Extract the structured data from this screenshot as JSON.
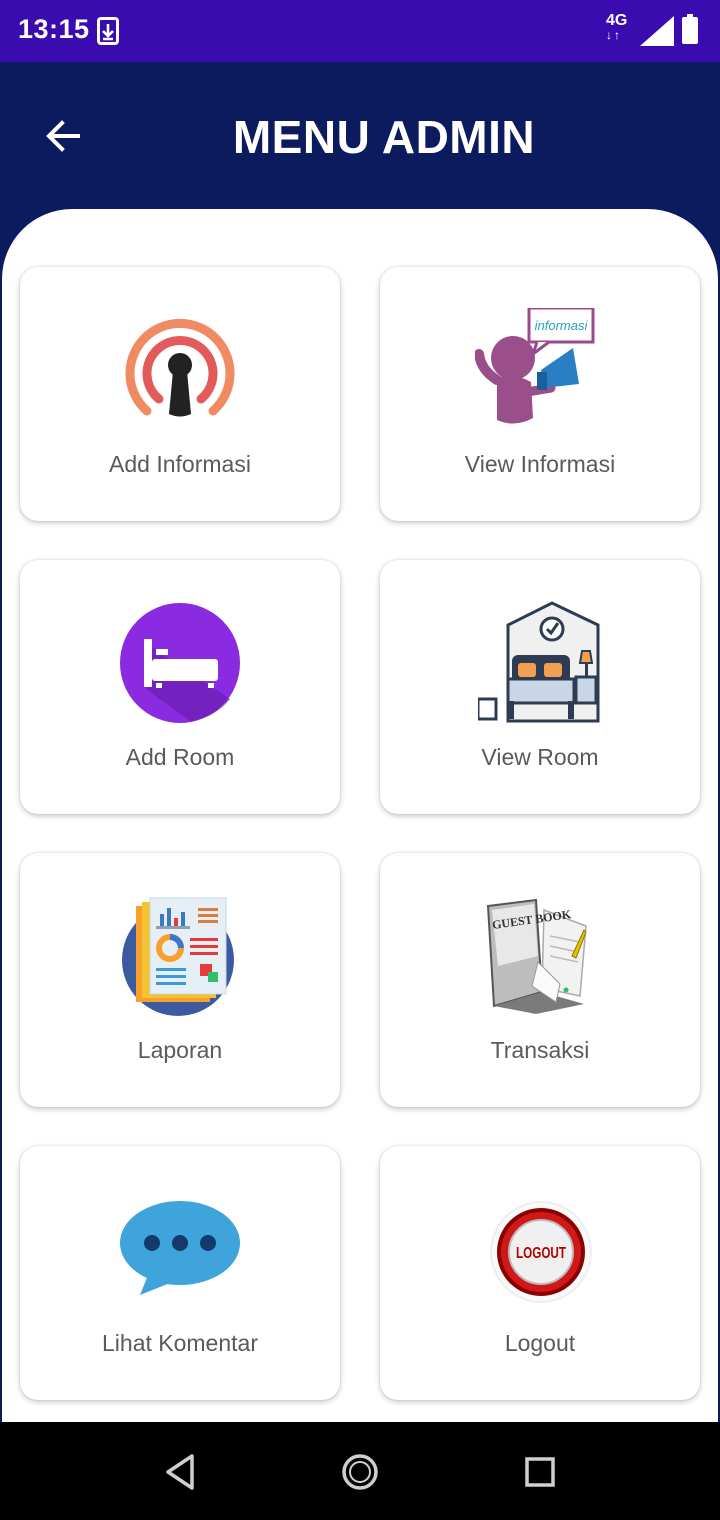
{
  "status_bar": {
    "time": "13:15",
    "network": "4G",
    "network_arrows": "↓↑"
  },
  "header": {
    "title": "MENU ADMIN",
    "back_icon": "arrow-back-icon"
  },
  "menu": [
    {
      "label": "Add Informasi",
      "icon": "broadcast-icon"
    },
    {
      "label": "View Informasi",
      "icon": "announcer-icon",
      "icon_text": "informasi"
    },
    {
      "label": "Add Room",
      "icon": "bed-icon"
    },
    {
      "label": "View Room",
      "icon": "bedroom-icon"
    },
    {
      "label": "Laporan",
      "icon": "report-icon"
    },
    {
      "label": "Transaksi",
      "icon": "guest-book-icon",
      "icon_text": "GUEST BOOK"
    },
    {
      "label": "Lihat Komentar",
      "icon": "chat-bubble-icon"
    },
    {
      "label": "Logout",
      "icon": "logout-icon",
      "icon_text": "LOGOUT"
    }
  ],
  "nav_bar": {
    "back": "nav-back-icon",
    "home": "nav-home-icon",
    "recents": "nav-recents-icon"
  },
  "colors": {
    "status_bar": "#3a0cb0",
    "app_bar": "#0c1a5e",
    "card_label": "#5a5a5a"
  }
}
